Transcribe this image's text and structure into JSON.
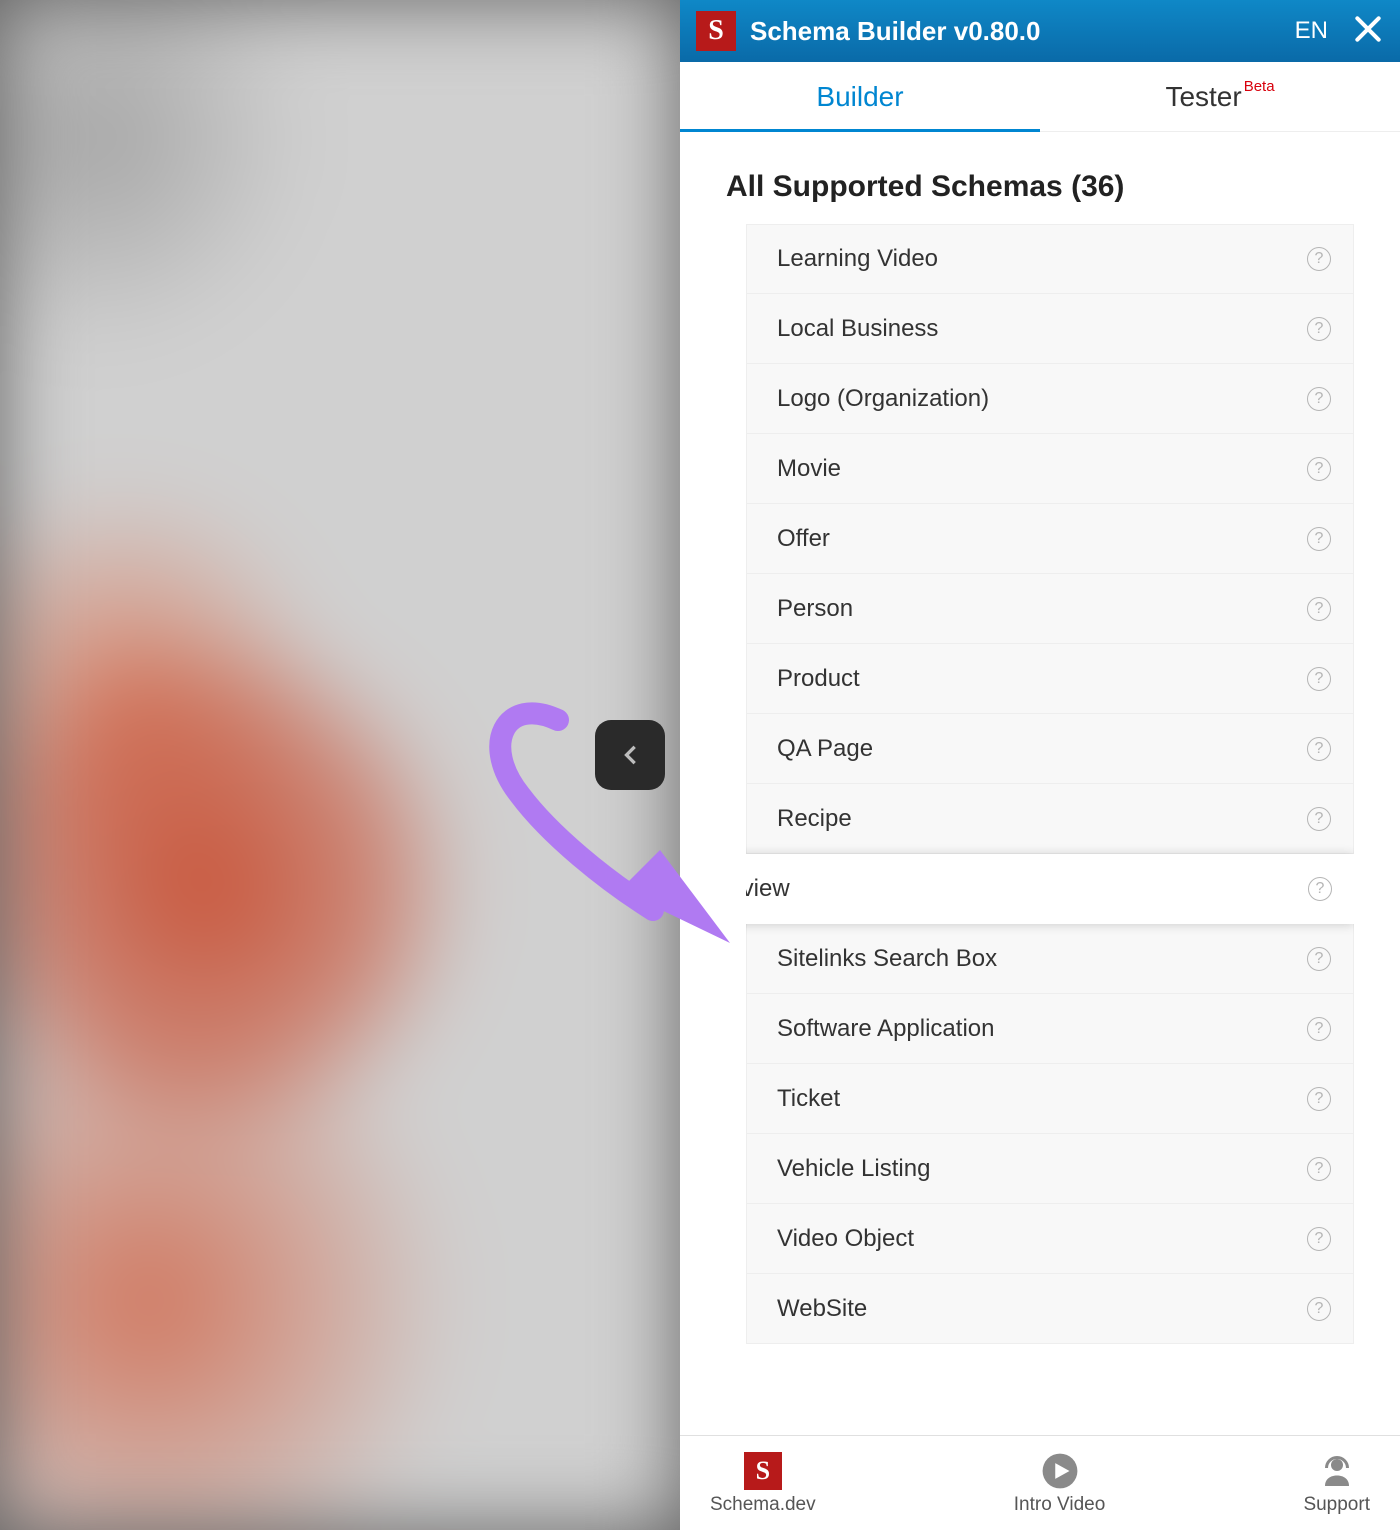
{
  "titlebar": {
    "logo_letter": "S",
    "title": "Schema Builder v0.80.0",
    "lang": "EN"
  },
  "tabs": {
    "builder": "Builder",
    "tester": "Tester",
    "tester_badge": "Beta"
  },
  "section_title": "All Supported Schemas (36)",
  "schemas": [
    {
      "label": "Learning Video"
    },
    {
      "label": "Local Business"
    },
    {
      "label": "Logo (Organization)"
    },
    {
      "label": "Movie"
    },
    {
      "label": "Offer"
    },
    {
      "label": "Person"
    },
    {
      "label": "Product"
    },
    {
      "label": "QA Page"
    },
    {
      "label": "Recipe"
    },
    {
      "label": "Review",
      "highlighted": true
    },
    {
      "label": "Sitelinks Search Box"
    },
    {
      "label": "Software Application"
    },
    {
      "label": "Ticket"
    },
    {
      "label": "Vehicle Listing"
    },
    {
      "label": "Video Object"
    },
    {
      "label": "WebSite"
    }
  ],
  "bottombar": {
    "schema_dev": {
      "letter": "S",
      "label": "Schema.dev"
    },
    "intro": "Intro Video",
    "support": "Support"
  }
}
